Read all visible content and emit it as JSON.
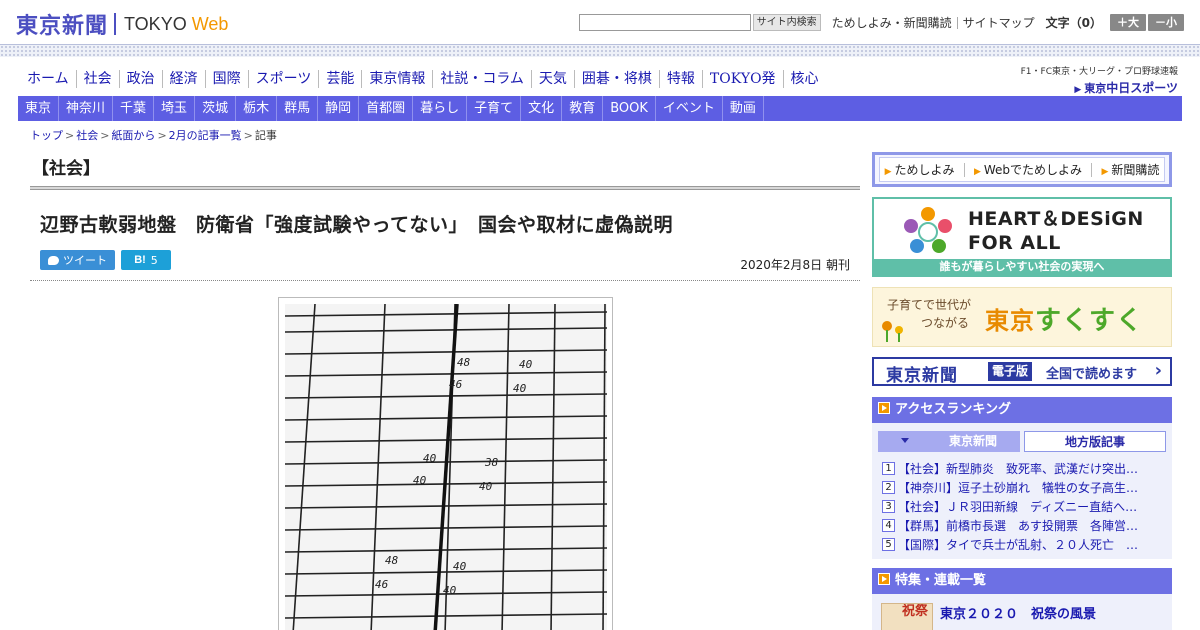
{
  "header": {
    "logo_jp": "東京新聞",
    "logo_tokyo": "TOKYO",
    "logo_web": "Web",
    "search_button": "サイト内検索",
    "links": [
      "ためしよみ・新聞購読",
      "サイトマップ"
    ],
    "text_size_label": "文字（0）",
    "size_up": "＋大",
    "size_down": "－小"
  },
  "main_nav": [
    "ホーム",
    "社会",
    "政治",
    "経済",
    "国際",
    "スポーツ",
    "芸能",
    "東京情報",
    "社説・コラム",
    "天気",
    "囲碁・将棋",
    "特報",
    "TOKYO発",
    "核心"
  ],
  "chunichi": {
    "sub": "F1・FC東京・大リーグ・プロ野球速報",
    "prefix": "東京",
    "name": "中日スポーツ"
  },
  "sub_nav": [
    "東京",
    "神奈川",
    "千葉",
    "埼玉",
    "茨城",
    "栃木",
    "群馬",
    "静岡",
    "首都圏",
    "暮らし",
    "子育て",
    "文化",
    "教育",
    "BOOK",
    "イベント",
    "動画"
  ],
  "breadcrumb": [
    "トップ",
    "社会",
    "紙面から",
    "2月の記事一覧",
    "記事"
  ],
  "article": {
    "section": "【社会】",
    "headline": "辺野古軟弱地盤　防衛省「強度試験やってない」　国会や取材に虚偽説明",
    "tweet": "ツイート",
    "hatena_logo": "B!",
    "hatena_count": "5",
    "date": "2020年2月8日 朝刊"
  },
  "photo_numbers": [
    "48",
    "40",
    "46",
    "40",
    "40",
    "38",
    "40",
    "40",
    "48",
    "40",
    "46",
    "40"
  ],
  "sidebar": {
    "trial_links": [
      "ためしよみ",
      "Webでためしよみ",
      "新聞購読"
    ],
    "heart_line1": "HEART＆DESiGN",
    "heart_line2": "FOR ALL",
    "heart_strip": "誰もが暮らしやすい社会の実現へ",
    "suku_small1": "子育てで世代が",
    "suku_small2": "つながる",
    "suku_big1": "東京",
    "suku_big2": "すくすく",
    "denshi_name": "東京新聞",
    "denshi_tag": "電子版",
    "denshi_read": "全国で読めます",
    "ranking_title": "アクセスランキング",
    "ranking_tabs": [
      "東京新聞",
      "地方版記事"
    ],
    "ranking": [
      {
        "num": "1",
        "text": "【社会】新型肺炎　致死率、武漢だけ突出…"
      },
      {
        "num": "2",
        "text": "【神奈川】逗子土砂崩れ　犠牲の女子高生…"
      },
      {
        "num": "3",
        "text": "【社会】ＪＲ羽田新線　ディズニー直結へ…"
      },
      {
        "num": "4",
        "text": "【群馬】前橋市長選　あす投開票　各陣営…"
      },
      {
        "num": "5",
        "text": "【国際】タイで兵士が乱射、２０人死亡　…"
      }
    ],
    "feature_title": "特集・連載一覧",
    "feature_item": "東京２０２０　祝祭の風景",
    "feature_thumb": "祝祭"
  },
  "colors": {
    "brand": "#4c4fc1",
    "subnav": "#5d5ee3",
    "accent": "#f39800",
    "panel": "#6d70e4",
    "heart": "#5fbfa8"
  }
}
